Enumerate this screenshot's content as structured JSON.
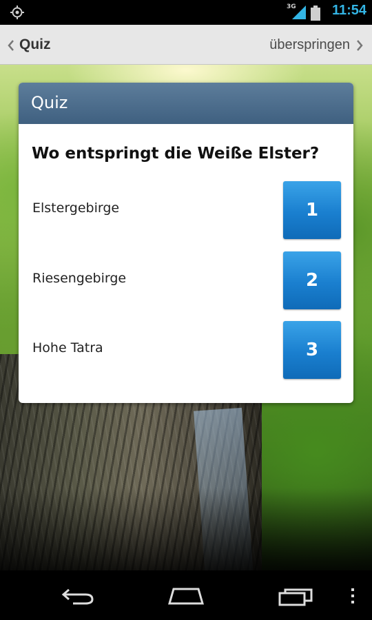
{
  "status_bar": {
    "network": "3G",
    "time": "11:54",
    "icons": [
      "location-icon",
      "signal-icon",
      "battery-icon"
    ]
  },
  "action_bar": {
    "title": "Quiz",
    "skip_label": "überspringen",
    "icons": [
      "back-chevron-icon",
      "forward-chevron-icon"
    ]
  },
  "card": {
    "title": "Quiz",
    "question": "Wo entspringt die Weiße Elster?",
    "answers": [
      {
        "text": "Elstergebirge",
        "button": "1"
      },
      {
        "text": "Riesengebirge",
        "button": "2"
      },
      {
        "text": "Hohe Tatra",
        "button": "3"
      }
    ]
  },
  "nav_bar": {
    "icons": [
      "back-icon",
      "home-icon",
      "recents-icon",
      "menu-icon"
    ]
  },
  "colors": {
    "status_time": "#33b5e5",
    "card_header": "#4a6b8a",
    "answer_button": "#1a7fcf",
    "action_bar": "#e7e7e7"
  }
}
